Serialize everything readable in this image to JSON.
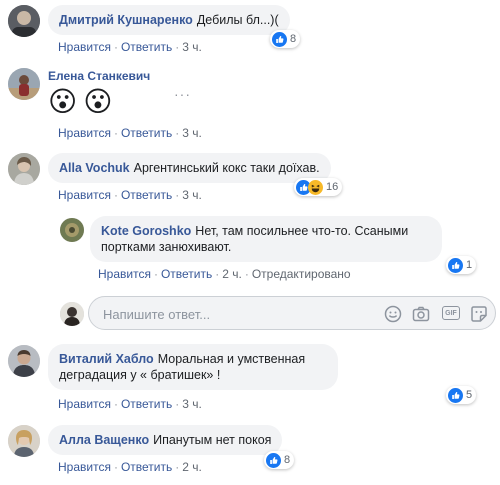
{
  "comments": [
    {
      "author": "Дмитрий Кушнаренко",
      "text": "Дебилы бл...)(",
      "like_label": "Нравится",
      "reply_label": "Ответить",
      "time": "3 ч.",
      "reaction_count": "8"
    },
    {
      "author": "Елена Станкевич",
      "text": "",
      "emoji": [
        "😮",
        "😮"
      ],
      "like_label": "Нравится",
      "reply_label": "Ответить",
      "time": "3 ч.",
      "more": "···"
    },
    {
      "author": "Alla Vochuk",
      "text": "Аргентинський кокс таки доїхав.",
      "like_label": "Нравится",
      "reply_label": "Ответить",
      "time": "3 ч.",
      "reaction_count": "16"
    },
    {
      "author": "Kote Goroshko",
      "text": "Нет, там посильнее что-то. Ссаными портками занюхивают.",
      "like_label": "Нравится",
      "reply_label": "Ответить",
      "time": "2 ч.",
      "edited": "Отредактировано",
      "reaction_count": "1"
    },
    {
      "author": "Виталий Хабло",
      "text": "Моральная и умственная деградация у « братишек» !",
      "like_label": "Нравится",
      "reply_label": "Ответить",
      "time": "3 ч.",
      "reaction_count": "5"
    },
    {
      "author": "Алла Ващенко",
      "text": "Ипанутым нет покоя",
      "like_label": "Нравится",
      "reply_label": "Ответить",
      "time": "2 ч.",
      "reaction_count": "8"
    }
  ],
  "reply_box": {
    "placeholder": "Напишите ответ...",
    "gif_label": "GIF"
  },
  "colors": {
    "link": "#385898",
    "bubble": "#f2f3f5",
    "like_blue": "#1877f2",
    "haha_yellow": "#f7b928"
  }
}
